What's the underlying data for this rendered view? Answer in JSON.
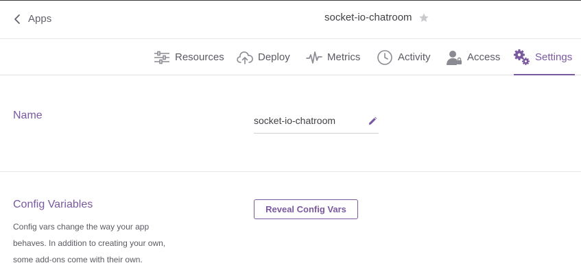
{
  "header": {
    "back_label": "Apps",
    "app_name": "socket-io-chatroom"
  },
  "tabs": [
    {
      "label": "Resources",
      "icon": "resources-icon"
    },
    {
      "label": "Deploy",
      "icon": "cloud-upload-icon"
    },
    {
      "label": "Metrics",
      "icon": "pulse-icon"
    },
    {
      "label": "Activity",
      "icon": "clock-icon"
    },
    {
      "label": "Access",
      "icon": "user-lock-icon"
    },
    {
      "label": "Settings",
      "icon": "gears-icon",
      "active": true
    }
  ],
  "name_section": {
    "label": "Name",
    "value": "socket-io-chatroom"
  },
  "config_section": {
    "label": "Config Variables",
    "description": "Config vars change the way your app behaves. In addition to creating your own, some add-ons come with their own.",
    "button_label": "Reveal Config Vars"
  },
  "colors": {
    "accent": "#79589f",
    "icon_gray": "#8a8a92",
    "text": "#3f3f44"
  }
}
